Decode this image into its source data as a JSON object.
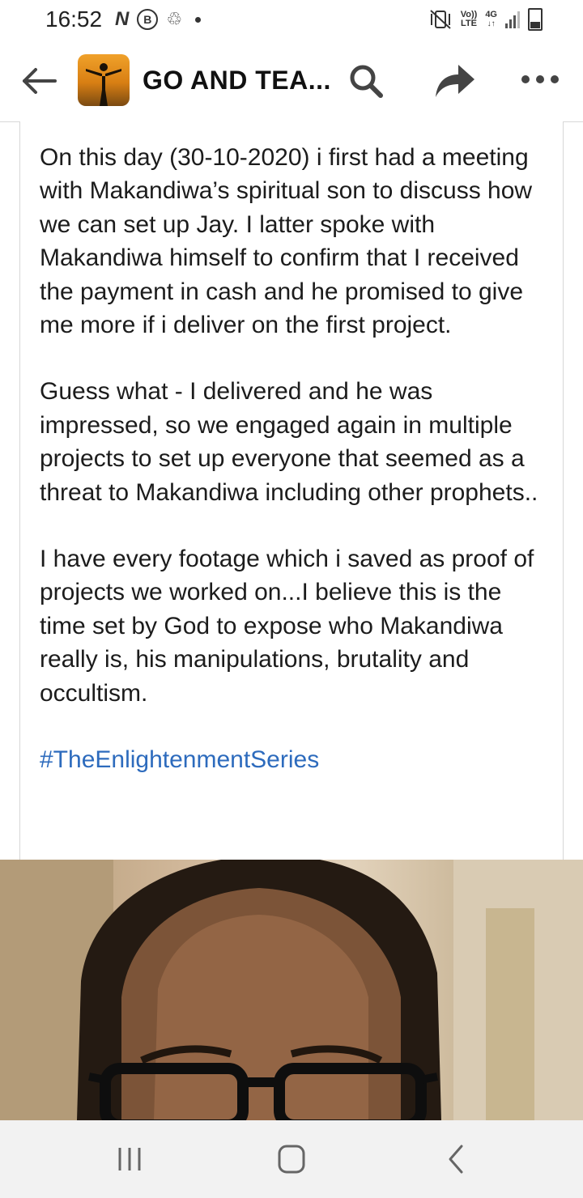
{
  "status_bar": {
    "time": "16:52",
    "left_icons": [
      "n-notification-icon",
      "b-notification-icon",
      "recycle-icon"
    ],
    "right_icons": [
      "mute-vibrate-icon",
      "volte-icon",
      "4g-icon",
      "signal-icon",
      "battery-icon"
    ],
    "volte_top": "Vo))",
    "volte_bottom": "LTE",
    "network": "4G"
  },
  "header": {
    "title": "GO AND TEA...",
    "icons": [
      "back-arrow-icon",
      "group-avatar",
      "search-icon",
      "share-icon",
      "more-icon"
    ]
  },
  "post": {
    "paragraphs": [
      "On this day (30-10-2020) i first had a meeting with Makandiwa’s spiritual son to discuss how we can set up Jay. I latter spoke with Makandiwa himself to confirm that I received the payment in cash and he promised to give me more if i deliver on the first project.",
      "Guess what - I delivered and he was impressed, so we engaged again in multiple projects to set up everyone that seemed as a threat to Makandiwa including other prophets..",
      "I have every footage which i saved as proof of projects we worked on...I believe this is the time set by God to expose who Makandiwa really is, his manipulations, brutality and occultism."
    ],
    "hashtag": "#TheEnlightenmentSeries",
    "hashtag_color": "#2d6bbd"
  },
  "nav_bar": {
    "icons": [
      "recent-apps-icon",
      "home-icon",
      "back-icon"
    ]
  }
}
